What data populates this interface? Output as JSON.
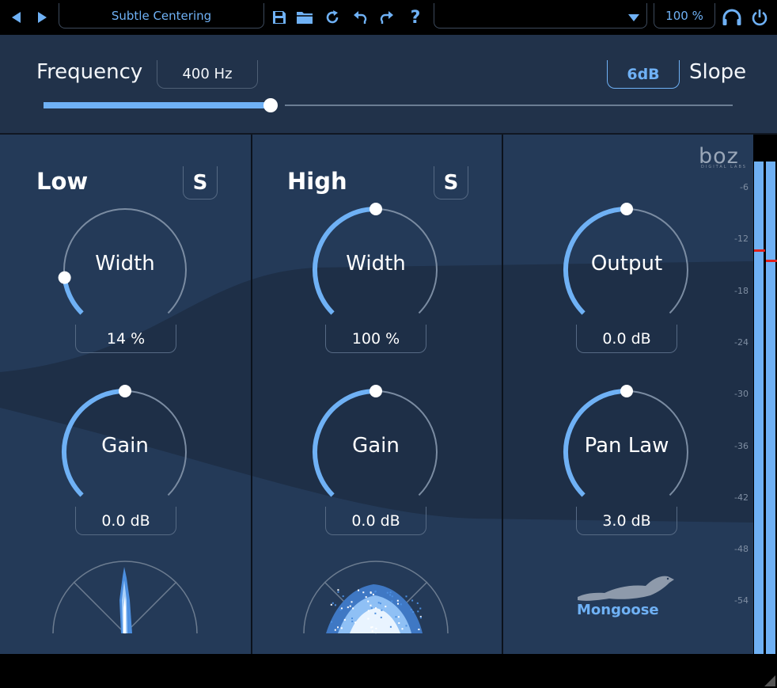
{
  "toolbar": {
    "preset_name": "Subtle Centering",
    "zoom": "100 %",
    "icons": [
      "prev-preset-icon",
      "next-preset-icon",
      "save-icon",
      "folder-icon",
      "reset-icon",
      "undo-icon",
      "redo-icon",
      "help-icon",
      "dropdown-icon",
      "headphones-icon",
      "power-icon"
    ]
  },
  "frequency": {
    "label": "Frequency",
    "value": "400 Hz",
    "slider_fraction": 0.33,
    "slope_value": "6dB",
    "slope_label": "Slope"
  },
  "low": {
    "title": "Low",
    "solo": "S",
    "width_label": "Width",
    "width_value": "14 %",
    "width_fraction": 0.14,
    "gain_label": "Gain",
    "gain_value": "0.0 dB",
    "gain_fraction": 0.5
  },
  "high": {
    "title": "High",
    "solo": "S",
    "width_label": "Width",
    "width_value": "100 %",
    "width_fraction": 0.5,
    "gain_label": "Gain",
    "gain_value": "0.0 dB",
    "gain_fraction": 0.5
  },
  "output": {
    "output_label": "Output",
    "output_value": "0.0 dB",
    "output_fraction": 0.5,
    "panlaw_label": "Pan Law",
    "panlaw_value": "3.0 dB",
    "panlaw_fraction": 0.5,
    "brand": "boz",
    "brand_sub": "DIGITAL LABS",
    "product": "Mongoose"
  },
  "meter": {
    "ticks": [
      "-6",
      "-12",
      "-18",
      "-24",
      "-30",
      "-36",
      "-42",
      "-48",
      "-54"
    ]
  },
  "colors": {
    "accent": "#6fb1f5",
    "panel": "#243a58",
    "peak": "#e0201c"
  }
}
